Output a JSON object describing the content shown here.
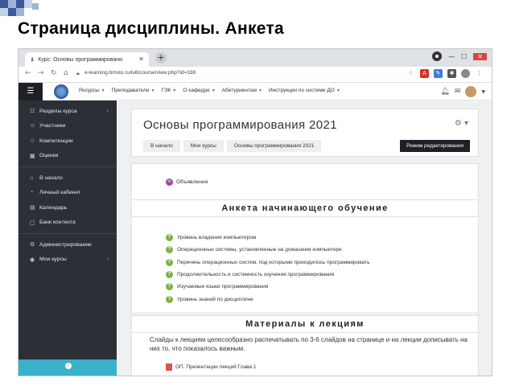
{
  "slide": {
    "title": "Страница дисциплины. Анкета"
  },
  "browser": {
    "tab_title": "Курс: Основы программировани",
    "url": "e-learning.bmstu.ru/iu6/course/view.php?id=338"
  },
  "topnav": {
    "items": [
      "Ресурсы",
      "Преподаватели",
      "ГЭК",
      "О кафедре",
      "Абитуриентам",
      "Инструкции по системе ДО"
    ]
  },
  "sidebar": {
    "group1": [
      {
        "label": "Разделы курса",
        "icon": "list-icon"
      },
      {
        "label": "Участники",
        "icon": "users-icon"
      },
      {
        "label": "Компетенции",
        "icon": "star-icon"
      },
      {
        "label": "Оценки",
        "icon": "grades-icon"
      }
    ],
    "group2": [
      {
        "label": "В начало",
        "icon": "home-icon"
      },
      {
        "label": "Личный кабинет",
        "icon": "dashboard-icon"
      },
      {
        "label": "Календарь",
        "icon": "calendar-icon"
      },
      {
        "label": "Банк контента",
        "icon": "file-icon"
      }
    ],
    "group3": [
      {
        "label": "Администрирование",
        "icon": "gear-icon"
      },
      {
        "label": "Мои курсы",
        "icon": "courses-icon"
      }
    ]
  },
  "course": {
    "title": "Основы программирования 2021",
    "breadcrumbs": [
      "В начало",
      "Мои курсы",
      "Основы программирования 2021"
    ],
    "edit_button": "Режим редактирования",
    "forum": "Объявления"
  },
  "sections": {
    "survey_title": "Анкета начинающего обучение",
    "survey_items": [
      "Уровень владения компьютером",
      "Операционные системы, установленные на домашнем компьютере",
      "Перечень операционных систем, под которыми приходилось программировать",
      "Продолжительность и системность изучения программирования",
      "Изучаемые языки программирования",
      "Уровень знаний по дисциплине"
    ],
    "lectures_title": "Материалы к лекциям",
    "lectures_text": "Слайды к лекциям целесообразно распечатывать по 3-6 слайдов на странице и на лекции дописывать на них то, что показалось важным.",
    "presentation": "ОП. Презентации лекций Глава 1"
  }
}
